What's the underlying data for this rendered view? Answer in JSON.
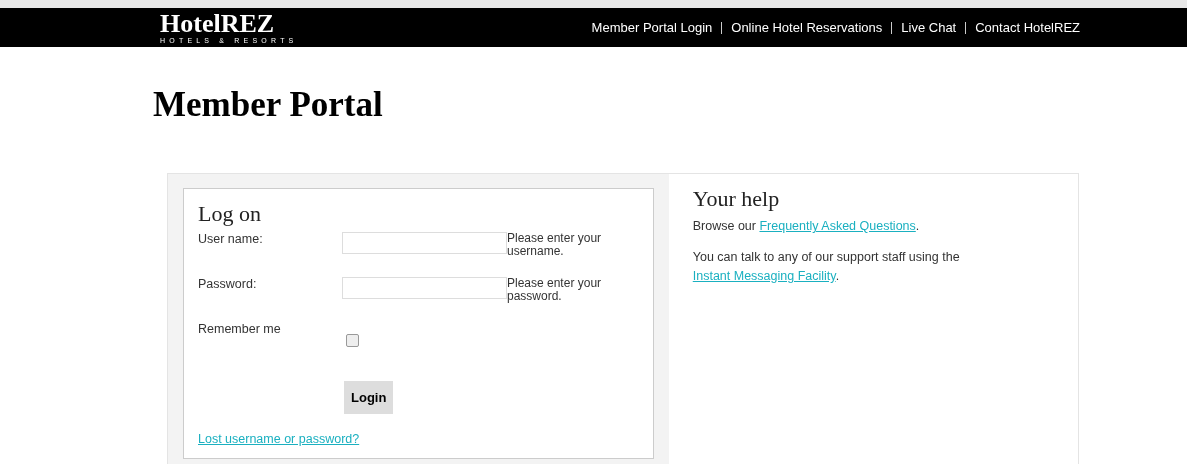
{
  "header": {
    "logo": {
      "name": "HotelREZ",
      "tagline": "HOTELS & RESORTS"
    },
    "nav": [
      {
        "label": "Member Portal Login"
      },
      {
        "label": "Online Hotel Reservations"
      },
      {
        "label": "Live Chat"
      },
      {
        "label": "Contact HotelREZ"
      }
    ]
  },
  "page_title": "Member Portal",
  "login": {
    "title": "Log on",
    "fields": [
      {
        "label": "User name:",
        "hint": "Please enter your username."
      },
      {
        "label": "Password:",
        "hint": "Please enter your password."
      }
    ],
    "remember": {
      "label": "Remember me",
      "checked": false
    },
    "button": "Login",
    "lost_link": "Lost username or password?"
  },
  "help": {
    "title": "Your help",
    "paragraphs": [
      {
        "before": "Browse our ",
        "link": "Frequently Asked Questions",
        "after": "."
      },
      {
        "before": "You can talk to any of our support staff using the ",
        "link": "Instant Messaging Facility",
        "after": "."
      }
    ]
  }
}
